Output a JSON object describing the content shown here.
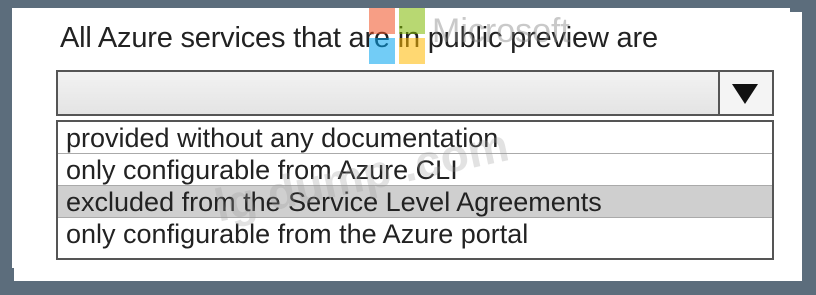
{
  "question": {
    "text": "All Azure services that are in public preview are"
  },
  "dropdown": {
    "selected_value": "",
    "options": [
      "provided without any documentation",
      "only configurable from Azure CLI",
      "excluded from the Service Level Agreements",
      "only configurable from the Azure portal"
    ],
    "highlighted_index": 2,
    "arrow_icon": "triangle-down-icon"
  },
  "watermark": {
    "brand_text": "Microsoft",
    "site_text": "lg dump .com",
    "logo_colors": [
      "#f25022",
      "#7fba00",
      "#00a4ef",
      "#ffb900"
    ]
  }
}
